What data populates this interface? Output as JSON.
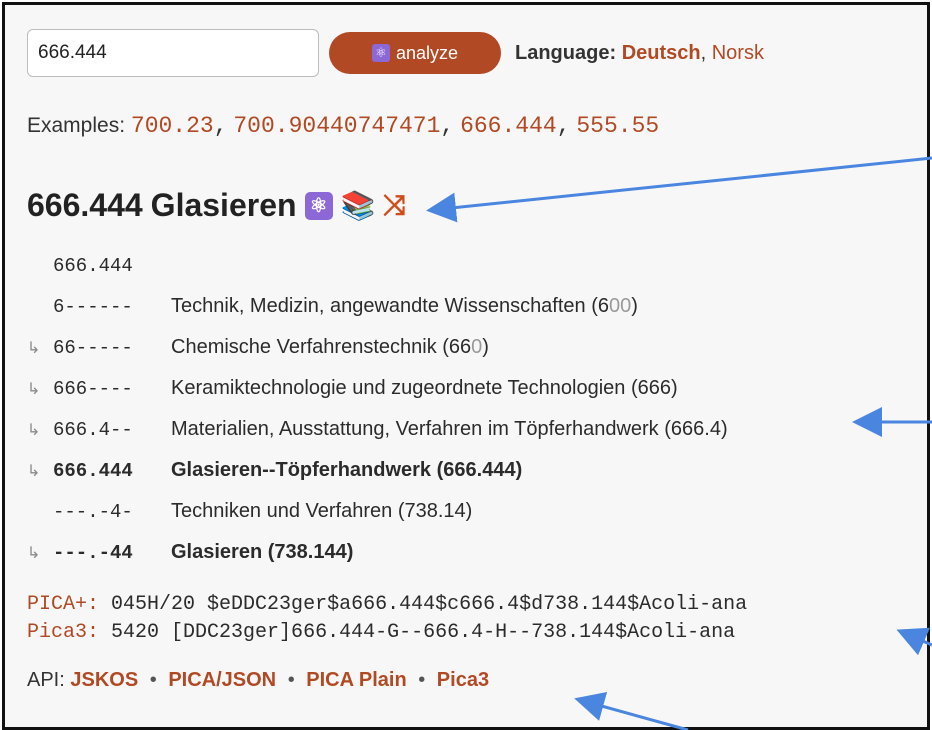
{
  "search": {
    "value": "666.444"
  },
  "analyze": {
    "label": "analyze",
    "icon": "atom-icon"
  },
  "language": {
    "label": "Language:",
    "active": "Deutsch",
    "separator": ",",
    "other": "Norsk"
  },
  "examples": {
    "label": "Examples:",
    "items": [
      "700.23",
      "700.90440747471",
      "666.444",
      "555.55"
    ]
  },
  "header": {
    "code": "666.444",
    "title": "Glasieren"
  },
  "hierarchy": [
    {
      "code": "666.444",
      "label": "",
      "arrow": false,
      "bold": false
    },
    {
      "code": "6------",
      "label": "Technik, Medizin, angewandte Wissenschaften",
      "number_main": "6",
      "number_faded": "00",
      "arrow": false,
      "bold": false
    },
    {
      "code": "66-----",
      "label": "Chemische Verfahrenstechnik",
      "number_main": "66",
      "number_faded": "0",
      "arrow": true,
      "bold": false
    },
    {
      "code": "666----",
      "label": "Keramiktechnologie und zugeordnete Technologien",
      "number_main": "666",
      "number_faded": "",
      "arrow": true,
      "bold": false
    },
    {
      "code": "666.4--",
      "label": "Materialien, Ausstattung, Verfahren im Töpferhandwerk",
      "number_main": "666.4",
      "number_faded": "",
      "arrow": true,
      "bold": false
    },
    {
      "code": "666.444",
      "label": "Glasieren--Töpferhandwerk",
      "number_main": "666.444",
      "number_faded": "",
      "arrow": true,
      "bold": true
    },
    {
      "code": "---.-4-",
      "label": "Techniken und Verfahren",
      "number_main": "738.14",
      "number_faded": "",
      "arrow": false,
      "bold": false
    },
    {
      "code": "---.-44",
      "label": "Glasieren",
      "number_main": "738.144",
      "number_faded": "",
      "arrow": true,
      "bold": true
    }
  ],
  "pica_plus": {
    "key": "PICA+:",
    "value": "045H/20 $eDDC23ger$a666.444$c666.4$d738.144$Acoli-ana"
  },
  "pica3": {
    "key": "Pica3:",
    "value": "5420 [DDC23ger]666.444-G--666.4-H--738.144$Acoli-ana"
  },
  "api": {
    "label": "API:",
    "separator": "•",
    "links": [
      "JSKOS",
      "PICA/JSON",
      "PICA Plain",
      "Pica3"
    ]
  },
  "colors": {
    "accent": "#b14a24",
    "annotation_arrow": "#4a86e0",
    "atom_badge": "#8c67d6"
  }
}
